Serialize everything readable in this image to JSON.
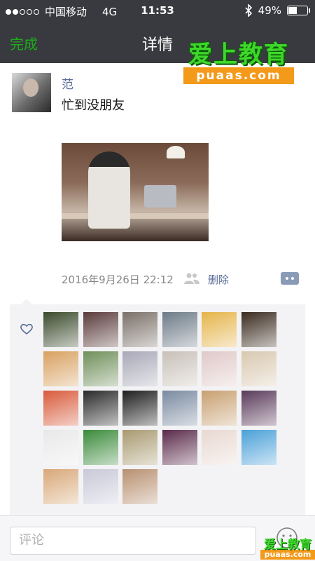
{
  "status_bar": {
    "carrier": "中国移动",
    "network": "4G",
    "time": "11:53",
    "battery_percent": "49%",
    "battery_level": 0.49,
    "signal_bars": 2
  },
  "nav": {
    "back_label": "完成",
    "title": "详情"
  },
  "watermark": {
    "title": "爱上教育",
    "subtitle": "puaas.com"
  },
  "post": {
    "user_name": "范",
    "text": "忙到没朋友",
    "timestamp": "2016年9月26日 22:12",
    "delete_label": "删除"
  },
  "likes": {
    "avatar_colors": [
      [
        "#3a4a2c",
        "#5a3a3a",
        "#7a7068",
        "#6c7a86",
        "#e5b44a",
        "#3a2a1e"
      ],
      [
        "#d8a060",
        "#6f8f5a",
        "#a8a8b8",
        "#c8c0b8",
        "#e0c8c8",
        "#d8c8b0"
      ],
      [
        "#d85a3a",
        "#2a2a2a",
        "#1e1e1e",
        "#7a8aa0",
        "#c8a070",
        "#5a3a5a"
      ],
      [
        "#e8e8e8",
        "#3a8a3a",
        "#a89a70",
        "#5a2a4a",
        "#e8d8d0",
        "#4aa0d8"
      ],
      [
        "#d8a878",
        "#c8c8d8",
        "#b89070"
      ]
    ]
  },
  "comment": {
    "placeholder": "评论"
  },
  "colors": {
    "nav_bg": "#393a3f",
    "accent_green": "#1aad19",
    "link_blue": "#576b95",
    "likes_bg": "#f3f3f5"
  },
  "icons": {
    "heart": "heart-icon",
    "people": "people-icon",
    "more": "more-icon",
    "emoji": "emoji-icon",
    "bluetooth": "bluetooth-icon"
  }
}
